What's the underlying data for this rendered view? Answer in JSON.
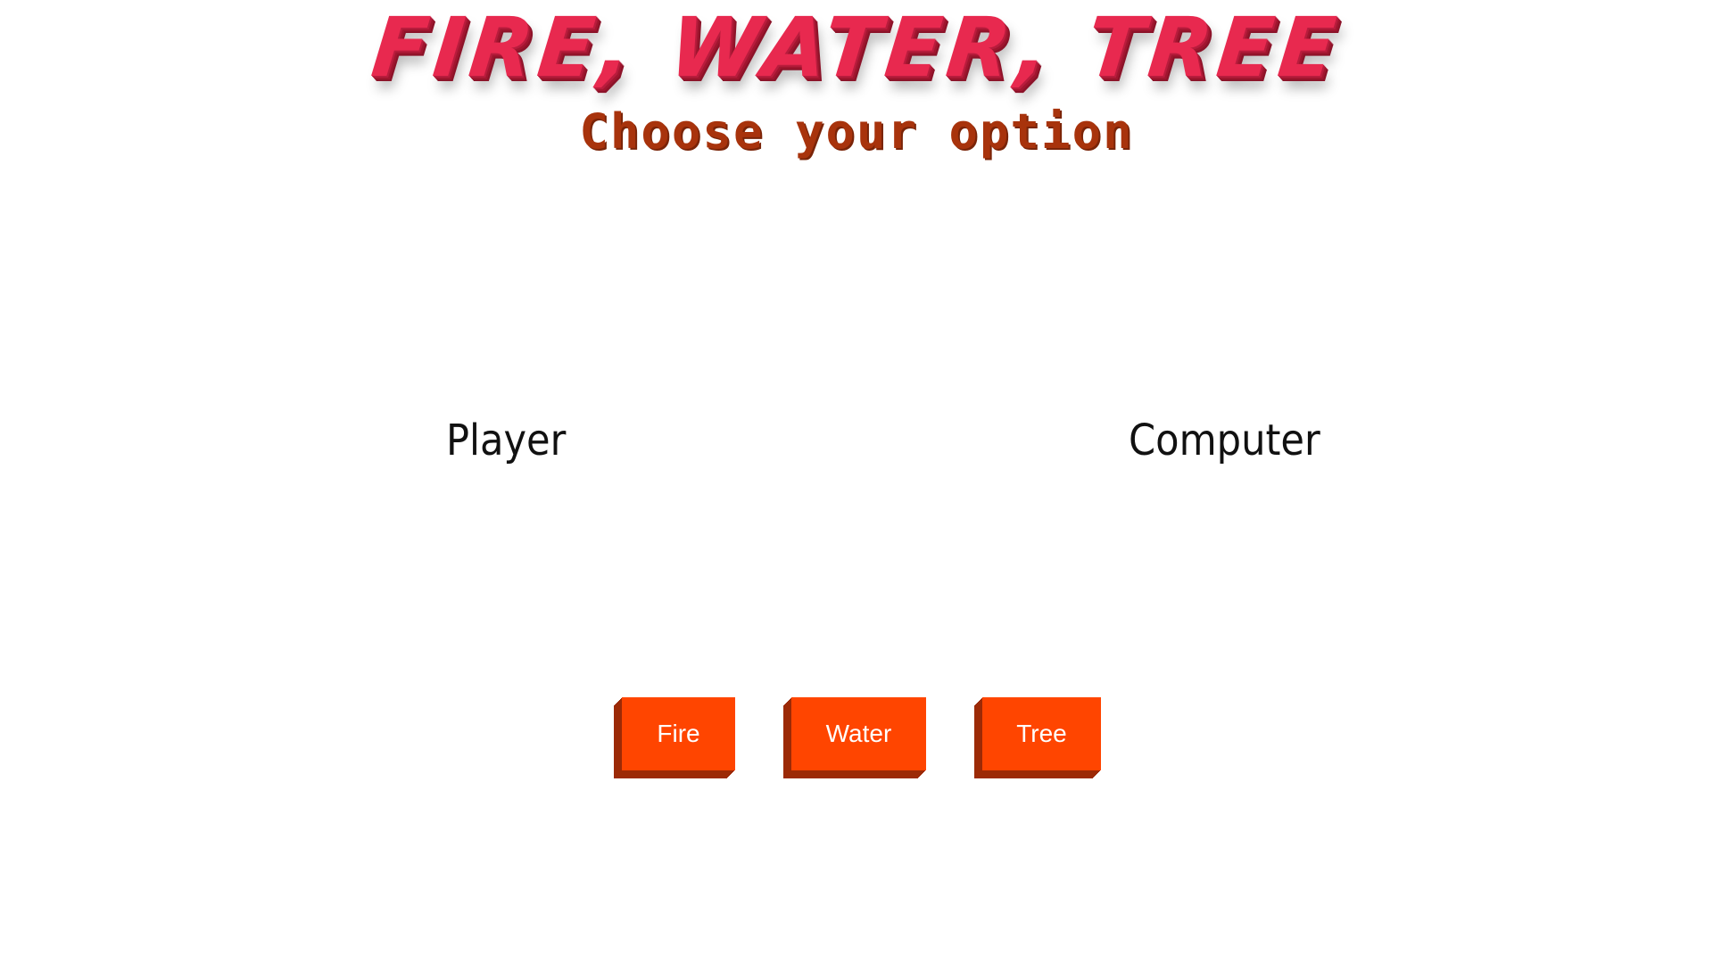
{
  "header": {
    "title": "FIRE, WATER, TREE",
    "subtitle": "Choose your option"
  },
  "scoreboard": {
    "player_label": "Player",
    "computer_label": "Computer"
  },
  "choices": {
    "fire": "Fire",
    "water": "Water",
    "tree": "Tree"
  },
  "colors": {
    "title": "#e8294f",
    "subtitle": "#a8330c",
    "button": "#ff4500",
    "button_shadow": "#9c2a06",
    "background": "#ffffff"
  }
}
